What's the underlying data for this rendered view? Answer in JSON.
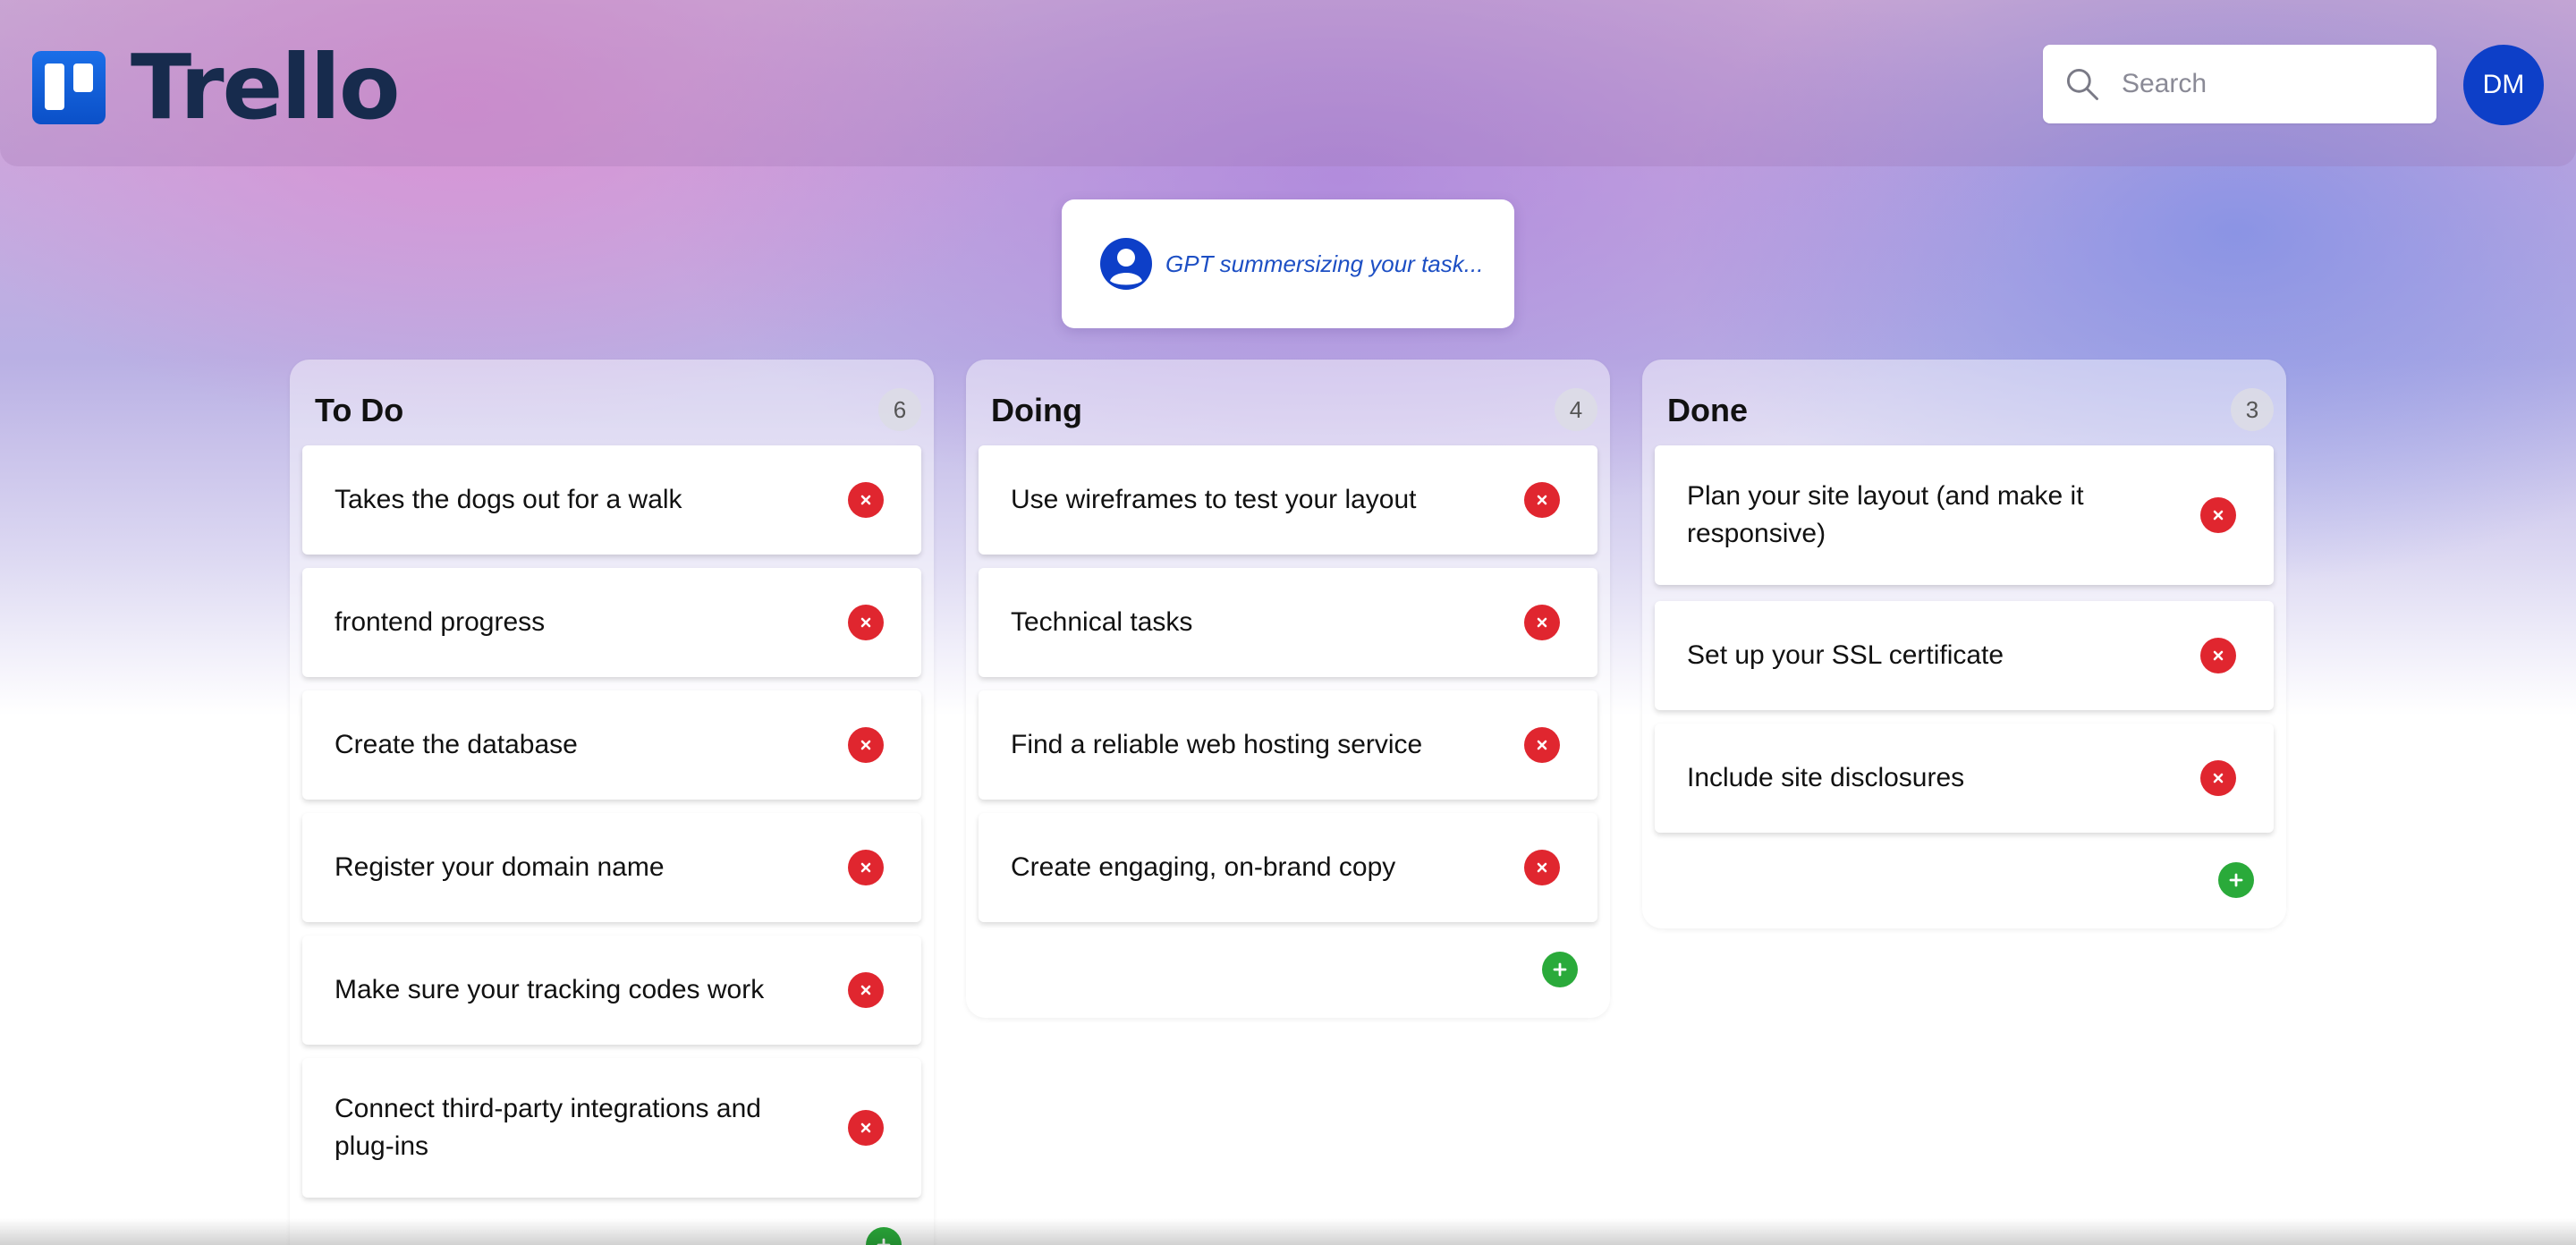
{
  "header": {
    "logo_text": "Trello",
    "search": {
      "placeholder": "Search",
      "value": ""
    },
    "avatar_initials": "DM"
  },
  "assistant_banner": {
    "text": "GPT summersizing your task..."
  },
  "columns": [
    {
      "title": "To Do",
      "count": "6",
      "cards": [
        "Takes the dogs out for a walk",
        "frontend progress",
        "Create the database",
        "Register your domain name",
        "Make sure your tracking codes work",
        "Connect third-party integrations and plug-ins"
      ]
    },
    {
      "title": "Doing",
      "count": "4",
      "cards": [
        "Use wireframes to test your layout",
        "Technical tasks",
        "Find a reliable web hosting service",
        "Create engaging, on-brand copy"
      ]
    },
    {
      "title": "Done",
      "count": "3",
      "cards": [
        "Plan your site layout (and make it responsive)",
        "Set up your SSL certificate",
        "Include site disclosures"
      ]
    }
  ],
  "icons": {
    "delete": "close-icon",
    "add": "plus-icon",
    "search": "search-icon",
    "assistant": "user-icon"
  },
  "colors": {
    "brand": "#0b50c8",
    "delete": "#e0262f",
    "add": "#2aaa3a",
    "assistant_text": "#1d4fc4"
  }
}
